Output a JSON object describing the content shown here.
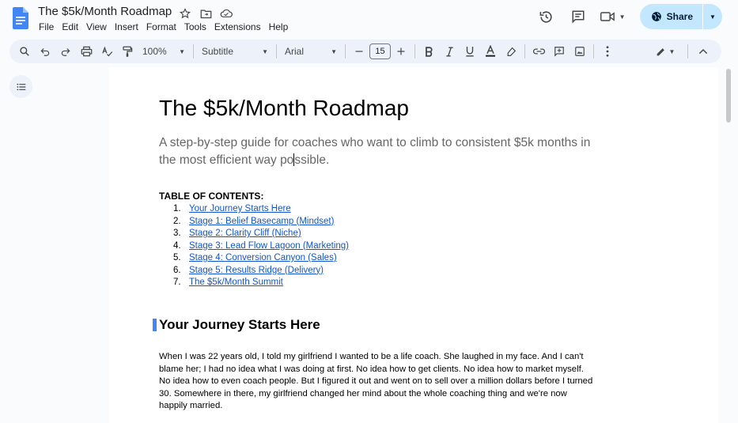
{
  "document": {
    "title": "The $5k/Month Roadmap"
  },
  "menu": [
    "File",
    "Edit",
    "View",
    "Insert",
    "Format",
    "Tools",
    "Extensions",
    "Help"
  ],
  "share": {
    "label": "Share"
  },
  "toolbar": {
    "zoom": "100%",
    "style": "Subtitle",
    "font": "Arial",
    "font_size": "15"
  },
  "content": {
    "heading": "The $5k/Month Roadmap",
    "subtitle_before_cursor": "A step-by-step guide for coaches who want to climb to consistent $5k months in the most efficient way po",
    "subtitle_after_cursor": "ssible.",
    "toc_heading": "TABLE OF CONTENTS:",
    "toc": [
      {
        "num": "1.",
        "label": "Your Journey Starts Here"
      },
      {
        "num": "2.",
        "label": "Stage 1: Belief Basecamp (Mindset)"
      },
      {
        "num": "3.",
        "label": "Stage 2: Clarity Cliff (Niche)"
      },
      {
        "num": "4.",
        "label": "Stage 3: Lead Flow Lagoon (Marketing)"
      },
      {
        "num": "5.",
        "label": "Stage 4: Conversion Canyon (Sales)"
      },
      {
        "num": "6.",
        "label": "Stage 5: Results Ridge (Delivery)"
      },
      {
        "num": "7.",
        "label": "The $5k/Month Summit"
      }
    ],
    "section_heading": "Your Journey Starts Here",
    "paragraph": "When I was 22 years old, I told my girlfriend I wanted to be a life coach. She laughed in my face. And I can't blame her; I had no idea what I was doing at first. No idea how to get clients. No idea how to market myself. No idea how to even coach people. But I figured it out and went on to sell over a million dollars before I turned 30. Somewhere in there, my girlfriend changed her mind about the whole coaching thing and we're now happily married."
  },
  "colors": {
    "accent": "#4285f4",
    "link": "#1155cc",
    "share_bg": "#c2e7ff",
    "toolbar_bg": "#edf2fa"
  },
  "icons": [
    "docs-logo-icon",
    "star-icon",
    "move-folder-icon",
    "cloud-status-icon",
    "history-icon",
    "comments-icon",
    "meet-icon",
    "globe-icon",
    "search-menus-icon",
    "undo-icon",
    "redo-icon",
    "print-icon",
    "spellcheck-icon",
    "paint-format-icon",
    "bold-icon",
    "italic-icon",
    "underline-icon",
    "text-color-icon",
    "highlight-icon",
    "link-icon",
    "add-comment-icon",
    "insert-image-icon",
    "more-icon",
    "editing-mode-icon",
    "collapse-icon",
    "outline-icon"
  ]
}
